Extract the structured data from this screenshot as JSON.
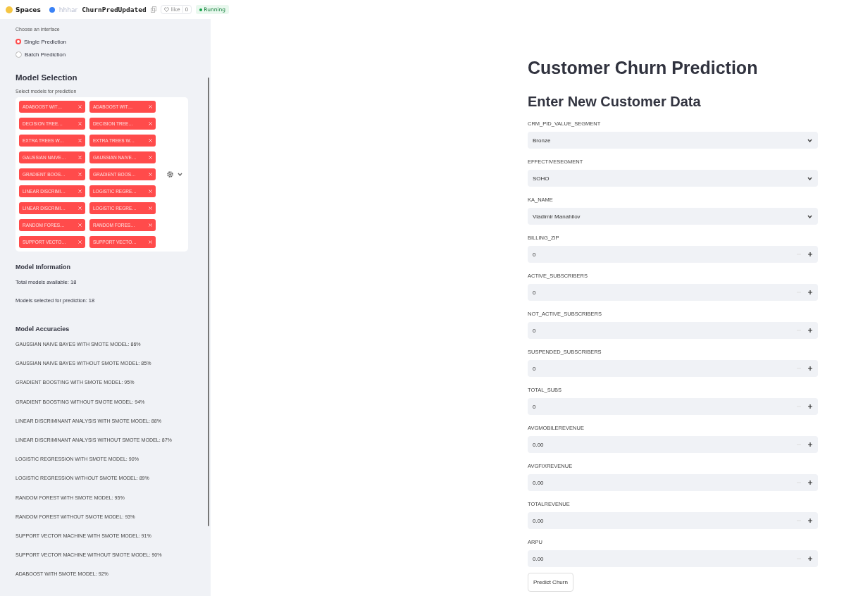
{
  "header": {
    "brand": "Spaces",
    "owner": "hhhar",
    "space_name": "ChurnPredUpdated",
    "like": {
      "label": "like",
      "count": "0"
    },
    "status": "Running"
  },
  "sidebar": {
    "interface_label": "Choose an interface",
    "interfaces": [
      {
        "label": "Single Prediction",
        "selected": true
      },
      {
        "label": "Batch Prediction",
        "selected": false
      }
    ],
    "model_selection": {
      "title": "Model Selection",
      "label": "Select models for prediction",
      "tags": [
        "ADABOOST WIT…",
        "ADABOOST WIT…",
        "DECISION TREE…",
        "DECISION TREE…",
        "EXTRA TREES W…",
        "EXTRA TREES W…",
        "GAUSSIAN NAIVE…",
        "GAUSSIAN NAIVE…",
        "GRADIENT BOOS…",
        "GRADIENT BOOS…",
        "LINEAR DISCRIMI…",
        "LOGISTIC REGRE…",
        "LINEAR DISCRIMI…",
        "LOGISTIC REGRE…",
        "RANDOM FORES…",
        "RANDOM FORES…",
        "SUPPORT VECTO…",
        "SUPPORT VECTO…"
      ]
    },
    "model_information": {
      "title": "Model Information",
      "lines": [
        "Total models available: 18",
        "Models selected for prediction: 18"
      ]
    },
    "model_accuracies": {
      "title": "Model Accuracies",
      "lines": [
        "GAUSSIAN NAIVE BAYES WITH SMOTE MODEL: 86%",
        "GAUSSIAN NAIVE BAYES WITHOUT SMOTE MODEL: 85%",
        "GRADIENT BOOSTING WITH SMOTE MODEL: 95%",
        "GRADIENT BOOSTING WITHOUT SMOTE MODEL: 94%",
        "LINEAR DISCRIMINANT ANALYSIS WITH SMOTE MODEL: 88%",
        "LINEAR DISCRIMINANT ANALYSIS WITHOUT SMOTE MODEL: 87%",
        "LOGISTIC REGRESSION WITH SMOTE MODEL: 90%",
        "LOGISTIC REGRESSION WITHOUT SMOTE MODEL: 89%",
        "RANDOM FOREST WITH SMOTE MODEL: 95%",
        "RANDOM FOREST WITHOUT SMOTE MODEL: 93%",
        "SUPPORT VECTOR MACHINE WITH SMOTE MODEL: 91%",
        "SUPPORT VECTOR MACHINE WITHOUT SMOTE MODEL: 90%",
        "ADABOOST WITH SMOTE MODEL: 92%"
      ]
    }
  },
  "main": {
    "title": "Customer Churn Prediction",
    "subtitle": "Enter New Customer Data",
    "fields": [
      {
        "kind": "select",
        "label": "CRM_PID_VALUE_SEGMENT",
        "value": "Bronze"
      },
      {
        "kind": "select",
        "label": "EFFECTIVESEGMENT",
        "value": "SOHO"
      },
      {
        "kind": "select",
        "label": "KA_NAME",
        "value": "Vladimir Manahilov"
      },
      {
        "kind": "number",
        "label": "BILLING_ZIP",
        "value": "0"
      },
      {
        "kind": "number",
        "label": "ACTIVE_SUBSCRIBERS",
        "value": "0"
      },
      {
        "kind": "number",
        "label": "NOT_ACTIVE_SUBSCRIBERS",
        "value": "0"
      },
      {
        "kind": "number",
        "label": "SUSPENDED_SUBSCRIBERS",
        "value": "0"
      },
      {
        "kind": "number",
        "label": "TOTAL_SUBS",
        "value": "0"
      },
      {
        "kind": "number",
        "label": "AVGMOBILEREVENUE",
        "value": "0.00"
      },
      {
        "kind": "number",
        "label": "AVGFIXREVENUE",
        "value": "0.00"
      },
      {
        "kind": "number",
        "label": "TOTALREVENUE",
        "value": "0.00"
      },
      {
        "kind": "number",
        "label": "ARPU",
        "value": "0.00"
      }
    ],
    "button": "Predict Churn"
  }
}
